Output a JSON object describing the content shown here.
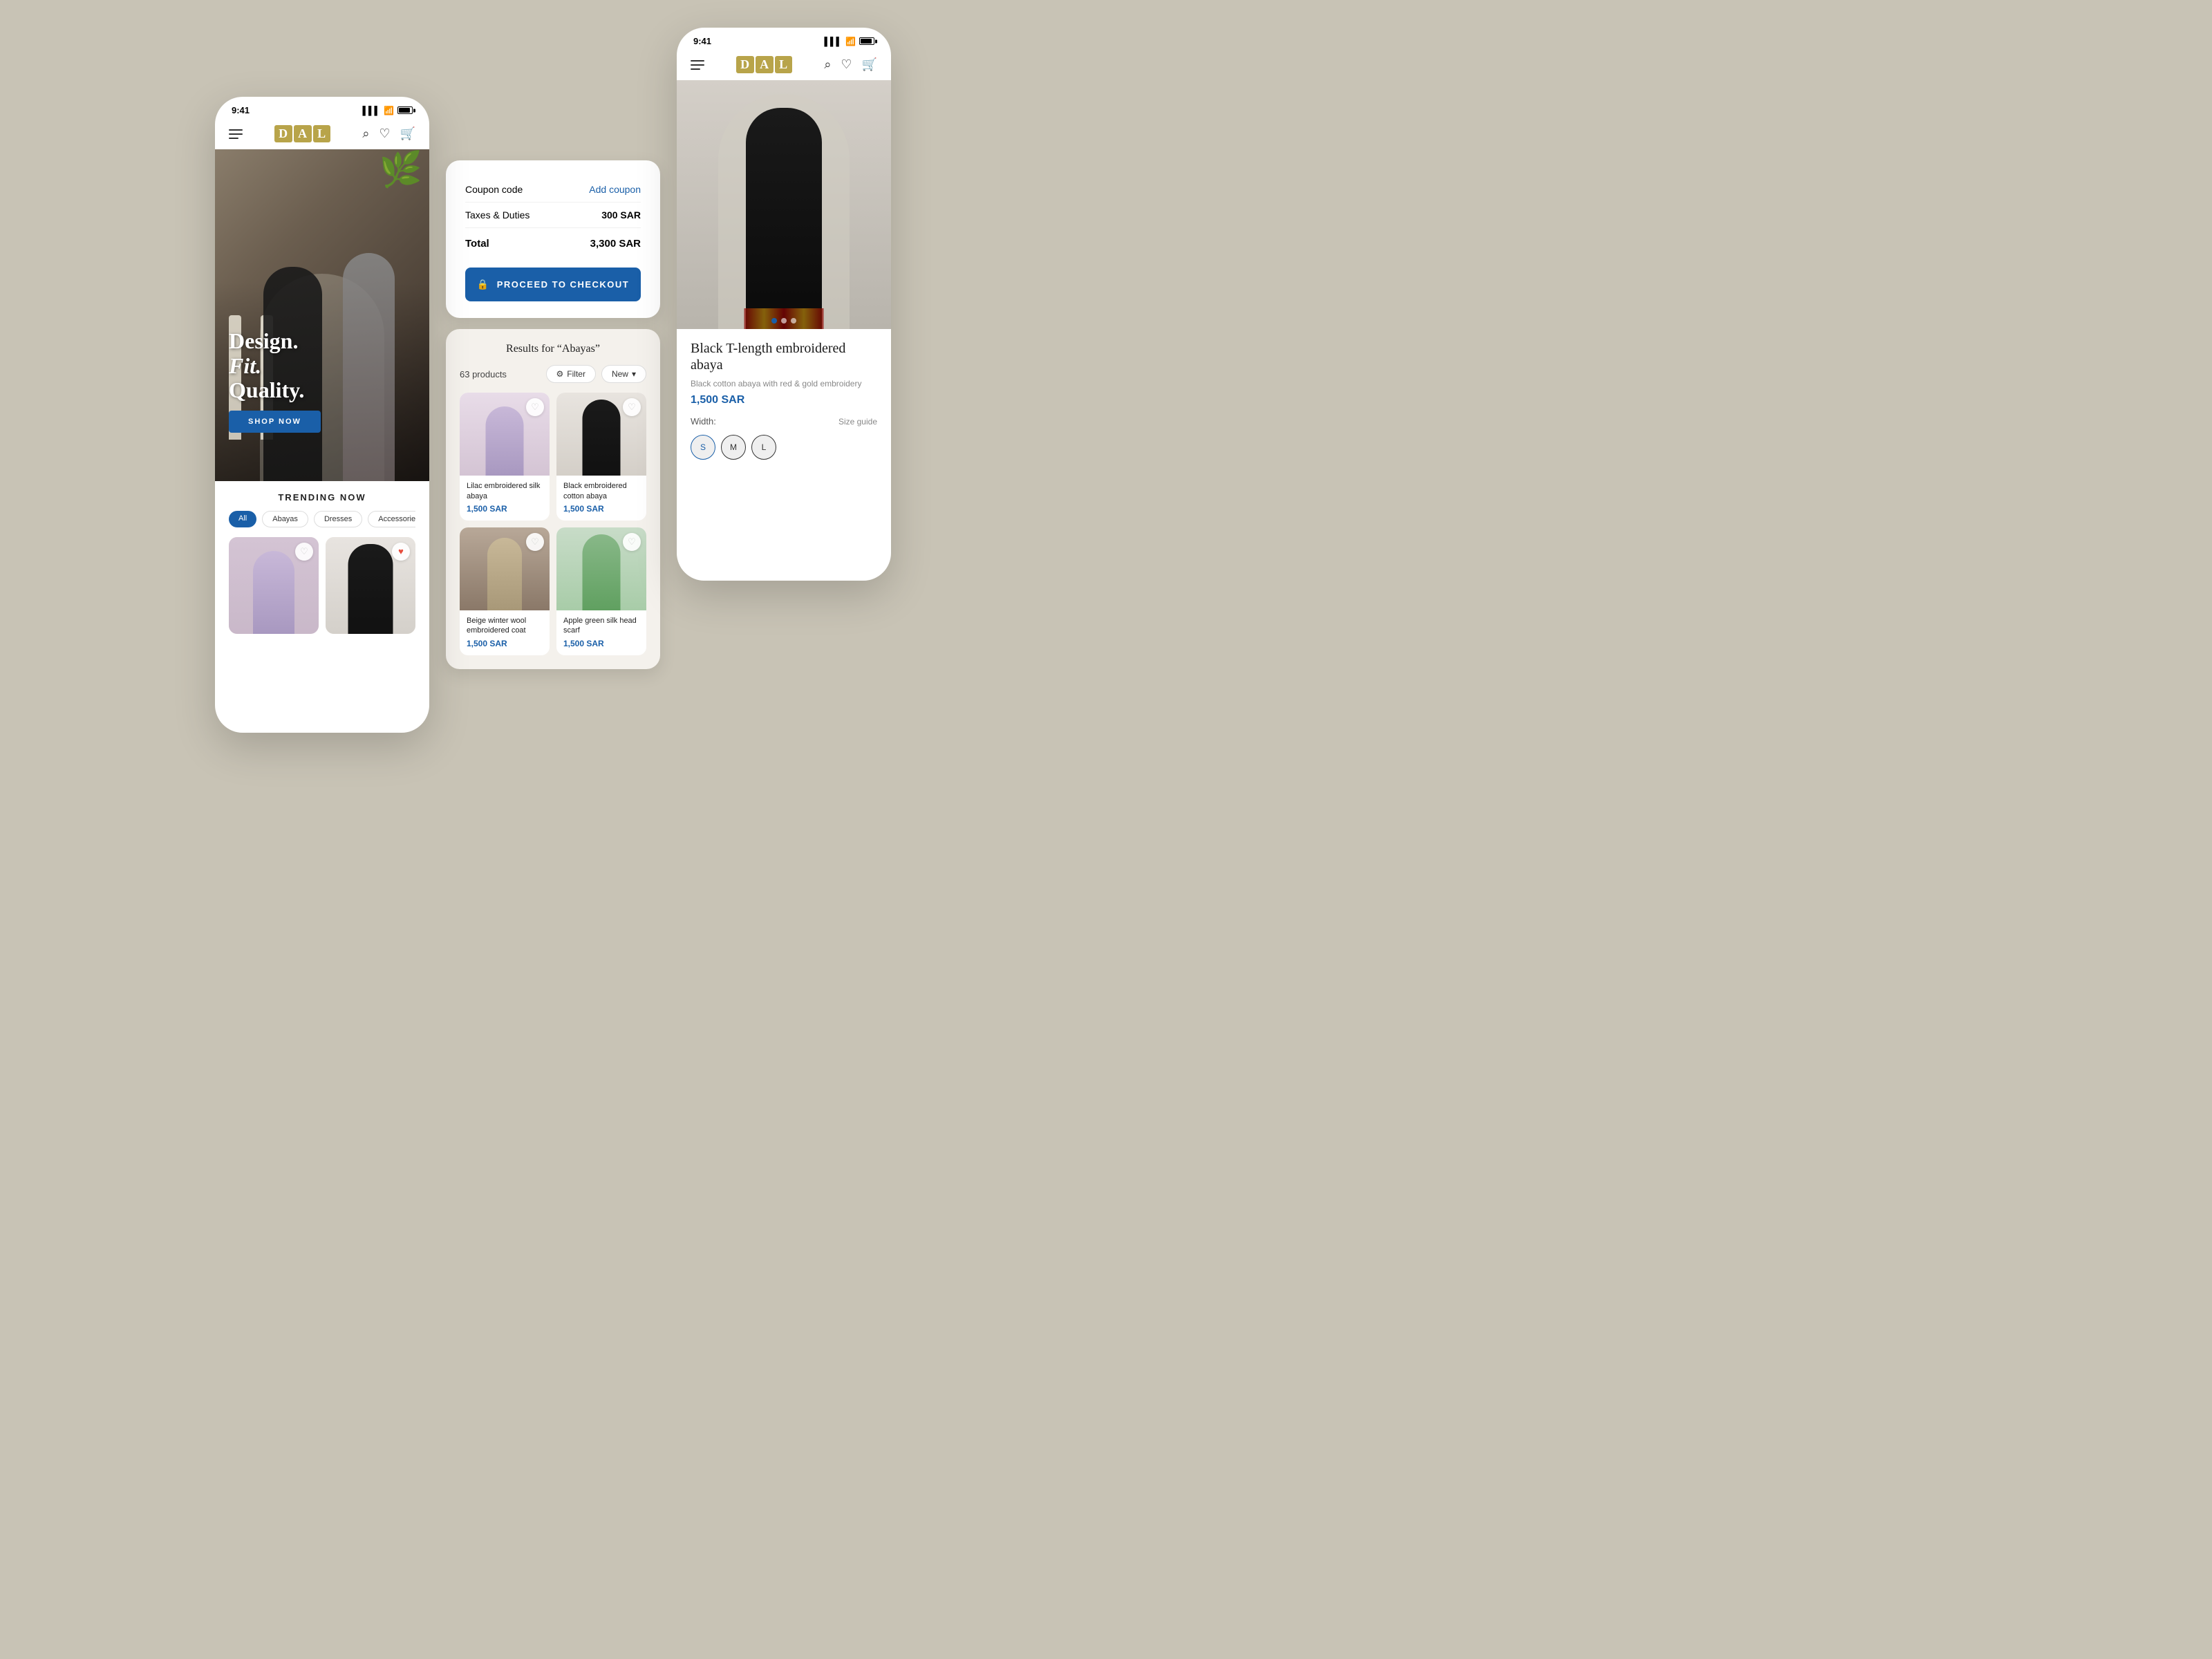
{
  "app": {
    "name": "DAL",
    "logo_letters": [
      "D",
      "A",
      "L"
    ]
  },
  "status_bar": {
    "time": "9:41",
    "time2": "9:41"
  },
  "phone1": {
    "hero": {
      "line1": "Design.",
      "line2": "Fit.",
      "line3": "Quality.",
      "cta": "SHOP NOW"
    },
    "trending": {
      "title": "TRENDING NOW",
      "categories": [
        "All",
        "Abayas",
        "Dresses",
        "Accessories"
      ]
    }
  },
  "cart": {
    "coupon_label": "Coupon code",
    "add_coupon": "Add coupon",
    "taxes_label": "Taxes & Duties",
    "taxes_amount": "300 SAR",
    "total_label": "Total",
    "total_amount": "3,300 SAR",
    "checkout_btn": "PROCEED TO CHECKOUT"
  },
  "search": {
    "query": "Abayas",
    "results_label": "Results for “Abayas”",
    "count": "63 products",
    "filter_btn": "Filter",
    "sort_btn": "New",
    "products": [
      {
        "name": "Lilac embroidered silk abaya",
        "price": "1,500 SAR",
        "img_class": "img-lilac"
      },
      {
        "name": "Black embroidered cotton abaya",
        "price": "1,500 SAR",
        "img_class": "img-black"
      },
      {
        "name": "Beige winter wool embroidered coat",
        "price": "1,500 SAR",
        "img_class": "img-beige"
      },
      {
        "name": "Apple green silk head scarf",
        "price": "1,500 SAR",
        "img_class": "img-green"
      }
    ]
  },
  "product_detail": {
    "title": "Black T-length embroidered abaya",
    "description": "Black cotton abaya with red & gold embroidery",
    "price": "1,500 SAR",
    "width_label": "Width:",
    "size_guide": "Size guide",
    "sizes": [
      "S",
      "M",
      "L"
    ]
  }
}
